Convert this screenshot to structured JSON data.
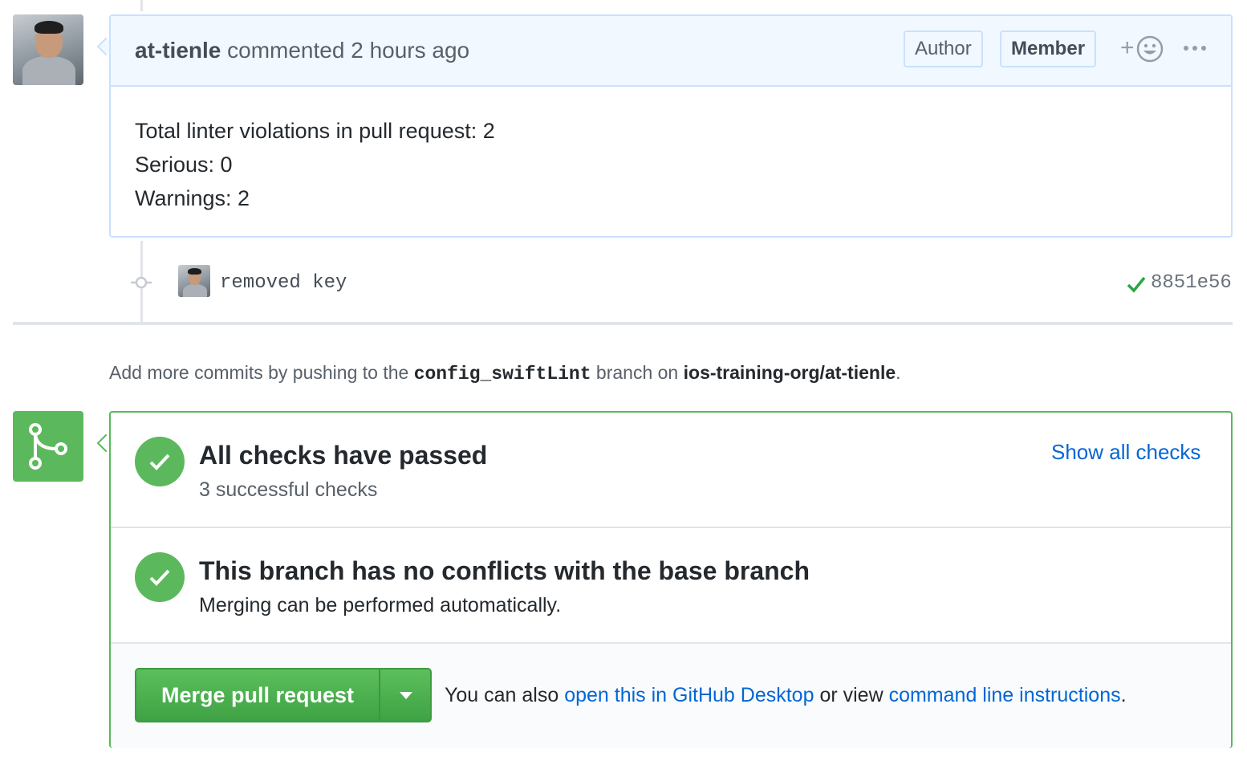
{
  "comment": {
    "author": "at-tienle",
    "action": "commented",
    "time": "2 hours ago",
    "badges": {
      "author": "Author",
      "member": "Member"
    },
    "reaction_plus": "+",
    "body_lines": [
      "Total linter violations in pull request: 2",
      "Serious: 0",
      "Warnings: 2"
    ]
  },
  "commit": {
    "message": "removed key",
    "sha": "8851e56",
    "status": "passed"
  },
  "push_note": {
    "prefix": "Add more commits by pushing to the",
    "branch": "config_swiftLint",
    "middle": "branch on",
    "repo": "ios-training-org/at-tienle",
    "suffix": "."
  },
  "merge": {
    "checks": {
      "title": "All checks have passed",
      "subtitle": "3 successful checks",
      "link": "Show all checks"
    },
    "conflicts": {
      "title": "This branch has no conflicts with the base branch",
      "subtitle": "Merging can be performed automatically."
    },
    "actions": {
      "merge_button": "Merge pull request",
      "prefix": "You can also",
      "desktop_link": "open this in GitHub Desktop",
      "middle": "or view",
      "cli_link": "command line instructions",
      "suffix": "."
    }
  },
  "colors": {
    "success": "#5cb85c",
    "link": "#0366d6",
    "header_bg": "#f1f8ff",
    "header_border": "#c8e1ff"
  },
  "icons": [
    "emoji-icon",
    "kebab-icon",
    "commit-node-icon",
    "check-icon",
    "merge-icon",
    "caret-down-icon"
  ]
}
